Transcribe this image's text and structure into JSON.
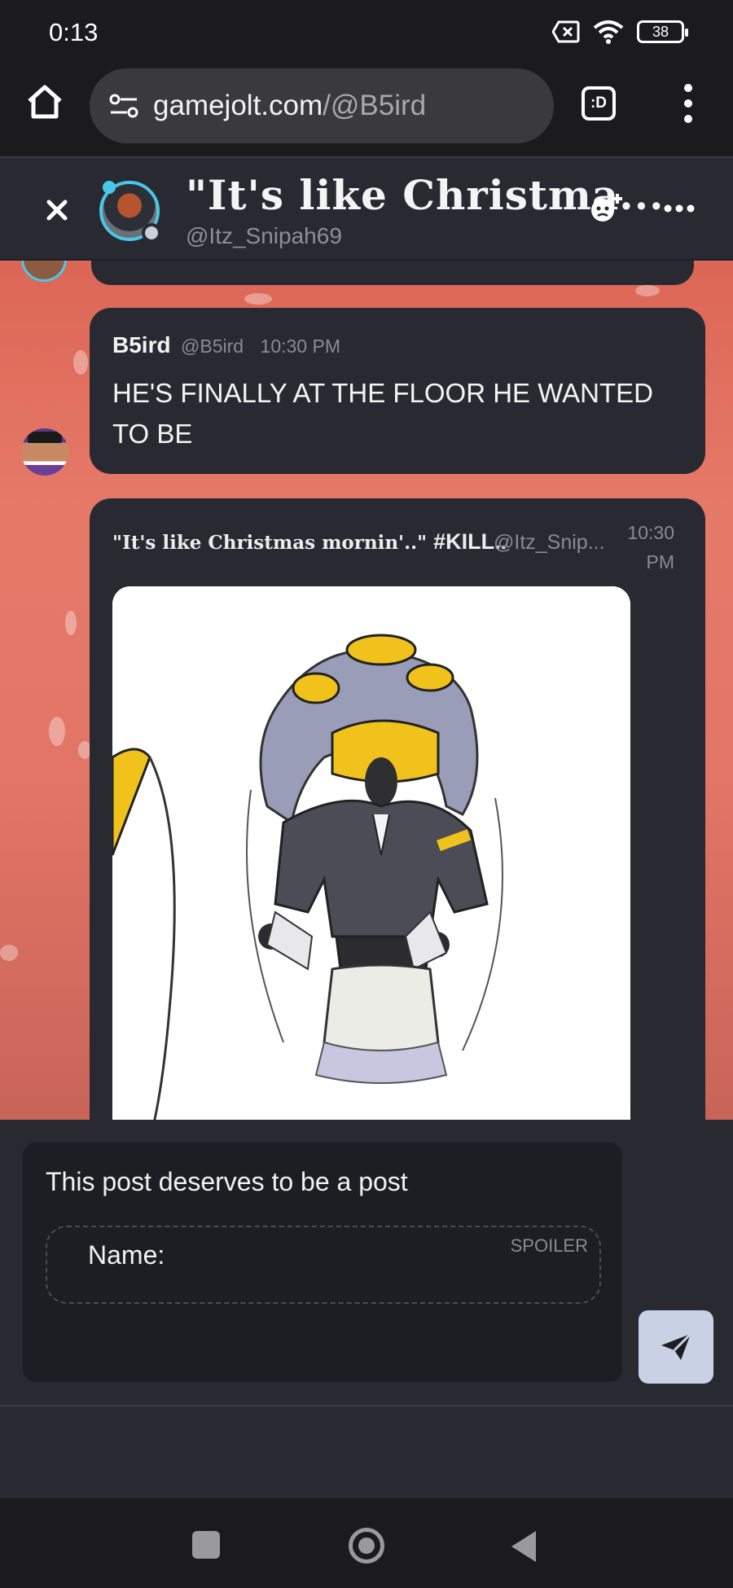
{
  "status_bar": {
    "time": "0:13",
    "battery": "38",
    "icons": [
      "no-sim-icon",
      "wifi-icon",
      "battery-icon"
    ]
  },
  "browser": {
    "url_domain": "gamejolt.com",
    "url_path": "/@B5ird",
    "tabs_label": ":D"
  },
  "chat_header": {
    "title": "\"It's like Christma...",
    "handle": "@Itz_Snipah69"
  },
  "messages": [
    {
      "author": "B5ird",
      "handle": "@B5ird",
      "time": "10:30 PM",
      "text": "HE'S FINALLY AT THE FLOOR HE WANTED TO BE"
    }
  ],
  "embed": {
    "title": "\"It's like Christmas mornin'..\"",
    "tag": "#KILL..",
    "handle": "@Itz_Snip...",
    "time_line1": "10:30",
    "time_line2": "PM"
  },
  "composer": {
    "text": "This post deserves to be a post",
    "spoiler_label": "SPOILER",
    "spoiler_text": "Name:"
  },
  "colors": {
    "chat_bg": "#e27566",
    "bubble": "#292a31",
    "accent": "#49c8e6",
    "send_button": "#c9d1e5"
  }
}
